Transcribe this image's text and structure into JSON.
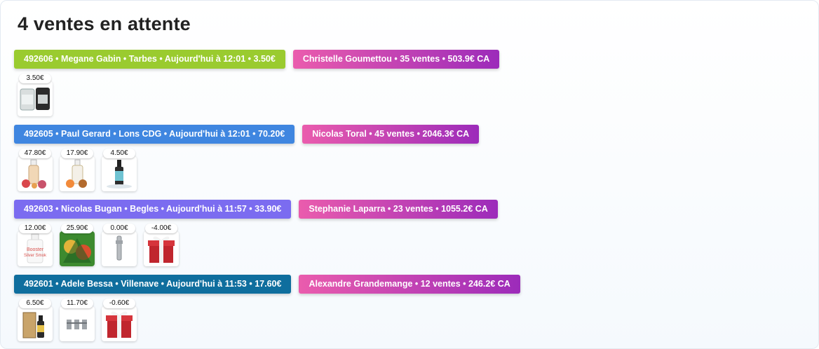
{
  "title": "4 ventes en attente",
  "sales": [
    {
      "order_label": "492606 • Megane Gabin • Tarbes • Aujourd'hui à 12:01 • 3.50€",
      "order_color": "#9acb2f",
      "client_label": "Christelle Goumettou • 35 ventes • 503.9€ CA",
      "items": [
        {
          "price": "3.50€",
          "icon": "tank-glass-icon"
        }
      ]
    },
    {
      "order_label": "492605 • Paul Gerard • Lons CDG • Aujourd'hui à 12:01 • 70.20€",
      "order_color": "#3f86e0",
      "client_label": "Nicolas Toral • 45 ventes • 2046.3€ CA",
      "items": [
        {
          "price": "47.80€",
          "icon": "eliquid-bottle-icon"
        },
        {
          "price": "17.90€",
          "icon": "eliquid-bottle-icon"
        },
        {
          "price": "4.50€",
          "icon": "eliquid-small-bottle-icon"
        }
      ]
    },
    {
      "order_label": "492603 • Nicolas Bugan • Begles • Aujourd'hui à 11:57 • 33.90€",
      "order_color": "#7b6cf0",
      "client_label": "Stephanie Laparra • 23 ventes • 1055.2€ CA",
      "items": [
        {
          "price": "12.00€",
          "icon": "booster-bottle-icon",
          "image_text": [
            "Booster",
            "Silver Smok"
          ]
        },
        {
          "price": "25.90€",
          "icon": "eliquid-box-icon"
        },
        {
          "price": "0.00€",
          "icon": "coil-icon"
        },
        {
          "price": "-4.00€",
          "icon": "gift-icon"
        }
      ]
    },
    {
      "order_label": "492601 • Adele Bessa • Villenave • Aujourd'hui à 11:53 • 17.60€",
      "order_color": "#0f6e9e",
      "client_label": "Alexandre Grandemange • 12 ventes • 246.2€ CA",
      "items": [
        {
          "price": "6.50€",
          "icon": "eliquid-box-icon"
        },
        {
          "price": "11.70€",
          "icon": "coils-pack-icon"
        },
        {
          "price": "-0.60€",
          "icon": "gift-icon"
        }
      ]
    }
  ]
}
